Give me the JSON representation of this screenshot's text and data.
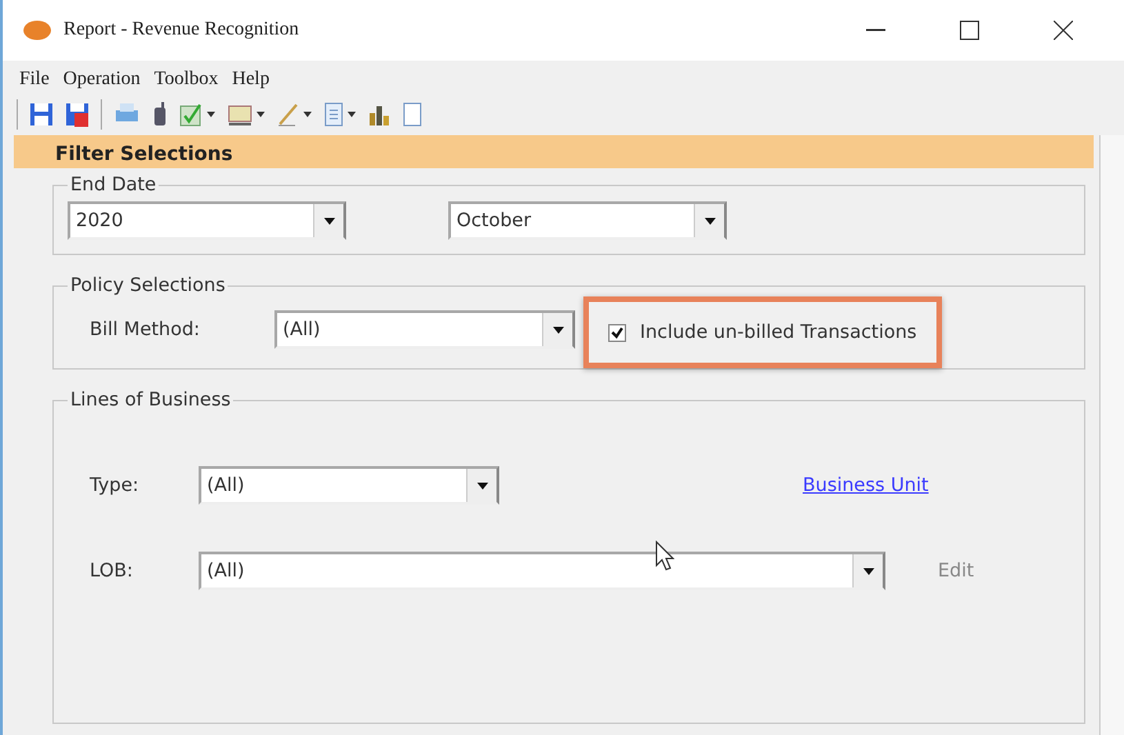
{
  "window": {
    "title": "Report - Revenue Recognition"
  },
  "menu": [
    "File",
    "Operation",
    "Toolbox",
    "Help"
  ],
  "toolbar": [
    {
      "kind": "save"
    },
    {
      "kind": "save-close"
    },
    {
      "kind": "separator"
    },
    {
      "kind": "print"
    },
    {
      "kind": "phone"
    },
    {
      "kind": "check",
      "dropdown": true
    },
    {
      "kind": "board",
      "dropdown": true
    },
    {
      "kind": "pencil",
      "dropdown": true
    },
    {
      "kind": "page",
      "dropdown": true
    },
    {
      "kind": "chart"
    },
    {
      "kind": "sheet"
    }
  ],
  "header": {
    "title": "Filter Selections"
  },
  "end_date": {
    "legend": "End Date",
    "year": "2020",
    "month": "October"
  },
  "policy": {
    "legend": "Policy Selections",
    "bill_method_label": "Bill Method:",
    "bill_method": "(All)",
    "include_unbilled": {
      "label": "Include un-billed Transactions",
      "checked": true,
      "highlighted": true
    }
  },
  "lines_of_business": {
    "legend": "Lines of Business",
    "type_label": "Type:",
    "type": "(All)",
    "business_unit_link": "Business Unit",
    "lob_label": "LOB:",
    "lob": "(All)",
    "edit": "Edit"
  }
}
